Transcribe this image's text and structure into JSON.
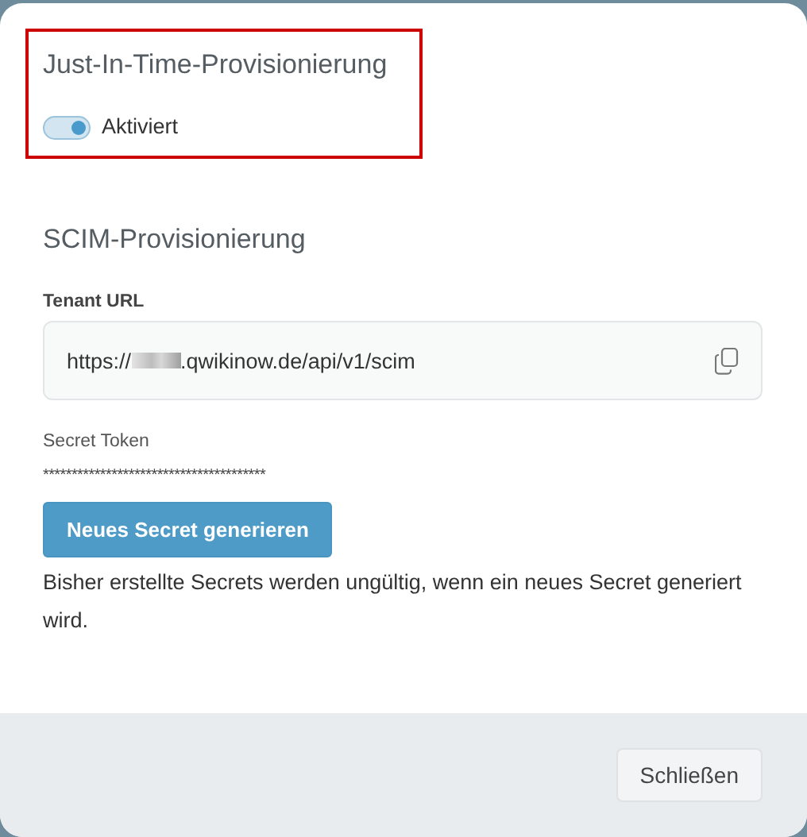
{
  "jit": {
    "title": "Just-In-Time-Provisionierung",
    "highlighted": true,
    "toggle": {
      "label": "Aktiviert",
      "on": true
    }
  },
  "scim": {
    "title": "SCIM-Provisionierung",
    "tenant_url": {
      "label": "Tenant URL",
      "value_start": "https://",
      "value_end": ".qwikinow.de/api/v1/scim"
    },
    "secret_token": {
      "label": "Secret Token",
      "value": "***************************************"
    },
    "generate_button": "Neues Secret generieren",
    "note": "Bisher erstellte Secrets werden ungültig, wenn ein neues Secret generiert wird."
  },
  "footer": {
    "buttons": [
      "Schließen"
    ]
  }
}
